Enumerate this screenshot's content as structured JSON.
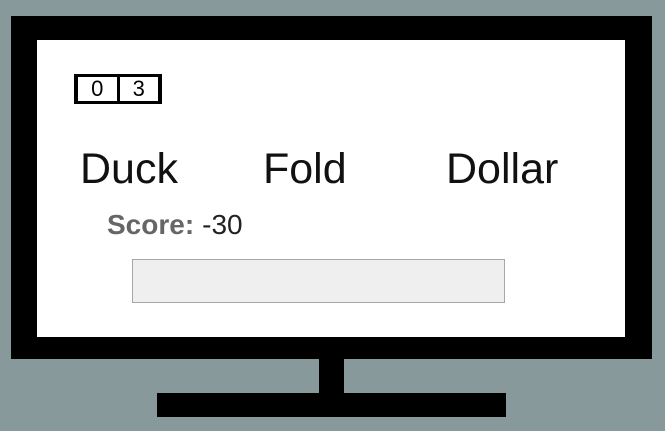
{
  "counter": {
    "digits": [
      "0",
      "3"
    ]
  },
  "words": [
    "Duck",
    "Fold",
    "Dollar"
  ],
  "score": {
    "label": "Score:",
    "value": "-30"
  },
  "answer": {
    "value": "",
    "placeholder": ""
  },
  "colors": {
    "background": "#87999a",
    "monitor": "#000000",
    "screen": "#ffffff",
    "input_fill": "#efefef",
    "score_label": "#666666"
  }
}
